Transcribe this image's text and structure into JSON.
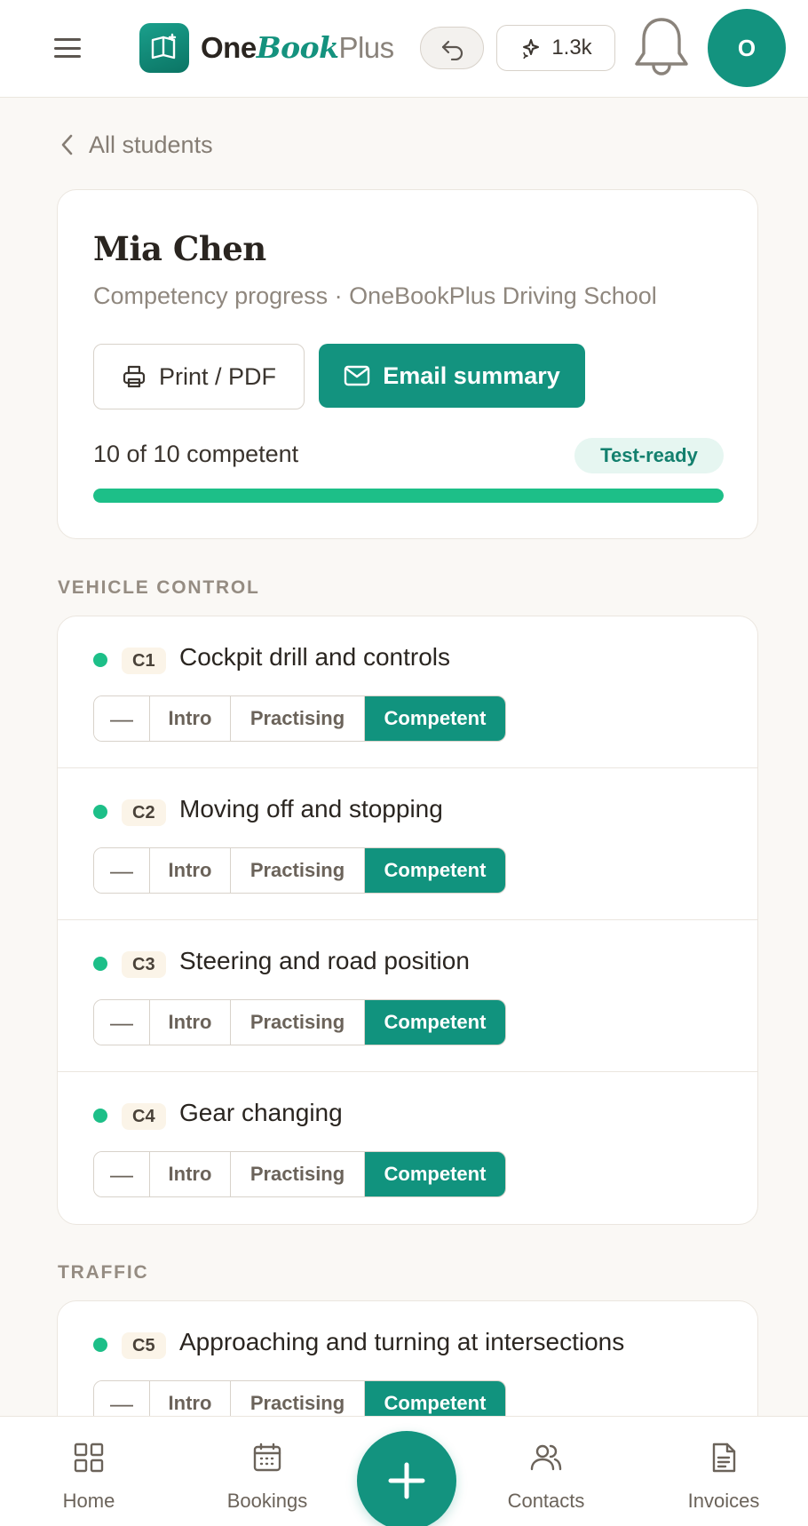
{
  "header": {
    "brand": {
      "part1": "One",
      "part2": "Book",
      "part3": "Plus"
    },
    "ai_credits": "1.3k",
    "avatar_initial": "O"
  },
  "breadcrumb": {
    "back_label": "All students"
  },
  "student": {
    "name": "Mia Chen",
    "subtitle": "Competency progress · OneBookPlus Driving School",
    "print_label": "Print / PDF",
    "email_label": "Email summary",
    "progress_text": "10 of 10 competent",
    "progress_fraction": 1.0,
    "badge": "Test-ready"
  },
  "level_labels": {
    "none": "—",
    "intro": "Intro",
    "practising": "Practising",
    "competent": "Competent"
  },
  "sections": [
    {
      "heading": "VEHICLE CONTROL",
      "items": [
        {
          "code": "C1",
          "title": "Cockpit drill and controls",
          "level": "competent"
        },
        {
          "code": "C2",
          "title": "Moving off and stopping",
          "level": "competent"
        },
        {
          "code": "C3",
          "title": "Steering and road position",
          "level": "competent"
        },
        {
          "code": "C4",
          "title": "Gear changing",
          "level": "competent"
        }
      ]
    },
    {
      "heading": "TRAFFIC",
      "items": [
        {
          "code": "C5",
          "title": "Approaching and turning at intersections",
          "level": "competent"
        }
      ]
    }
  ],
  "bottom_nav": {
    "home": "Home",
    "bookings": "Bookings",
    "contacts": "Contacts",
    "invoices": "Invoices"
  },
  "colors": {
    "brand": "#13937f",
    "competent_dot": "#1dbf88",
    "background": "#faf8f5"
  }
}
